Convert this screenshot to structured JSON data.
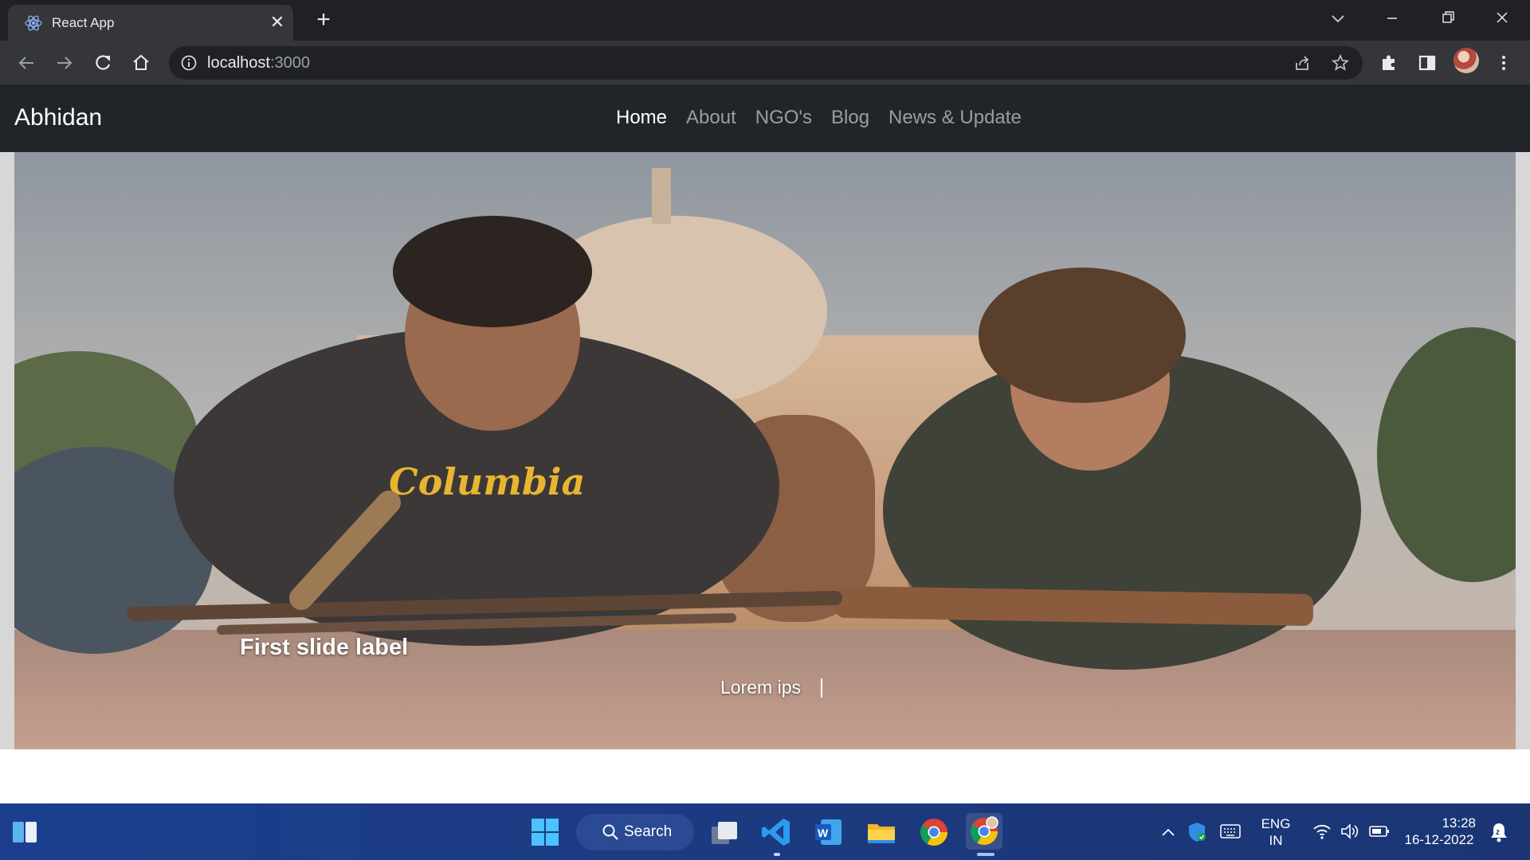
{
  "browser": {
    "tab_title": "React App",
    "url_host": "localhost",
    "url_port": ":3000"
  },
  "site": {
    "brand": "Abhidan",
    "nav": [
      {
        "label": "Home",
        "active": true
      },
      {
        "label": "About",
        "active": false
      },
      {
        "label": "NGO's",
        "active": false
      },
      {
        "label": "Blog",
        "active": false
      },
      {
        "label": "News & Update",
        "active": false
      }
    ],
    "carousel": {
      "caption_title": "First slide label",
      "caption_text": "Lorem ips"
    }
  },
  "taskbar": {
    "search_label": "Search",
    "language_line1": "ENG",
    "language_line2": "IN",
    "time": "13:28",
    "date": "16-12-2022"
  },
  "colors": {
    "navbar_bg": "#212529",
    "taskbar_bg": "#1c3a80",
    "chrome_bg": "#35363a"
  }
}
